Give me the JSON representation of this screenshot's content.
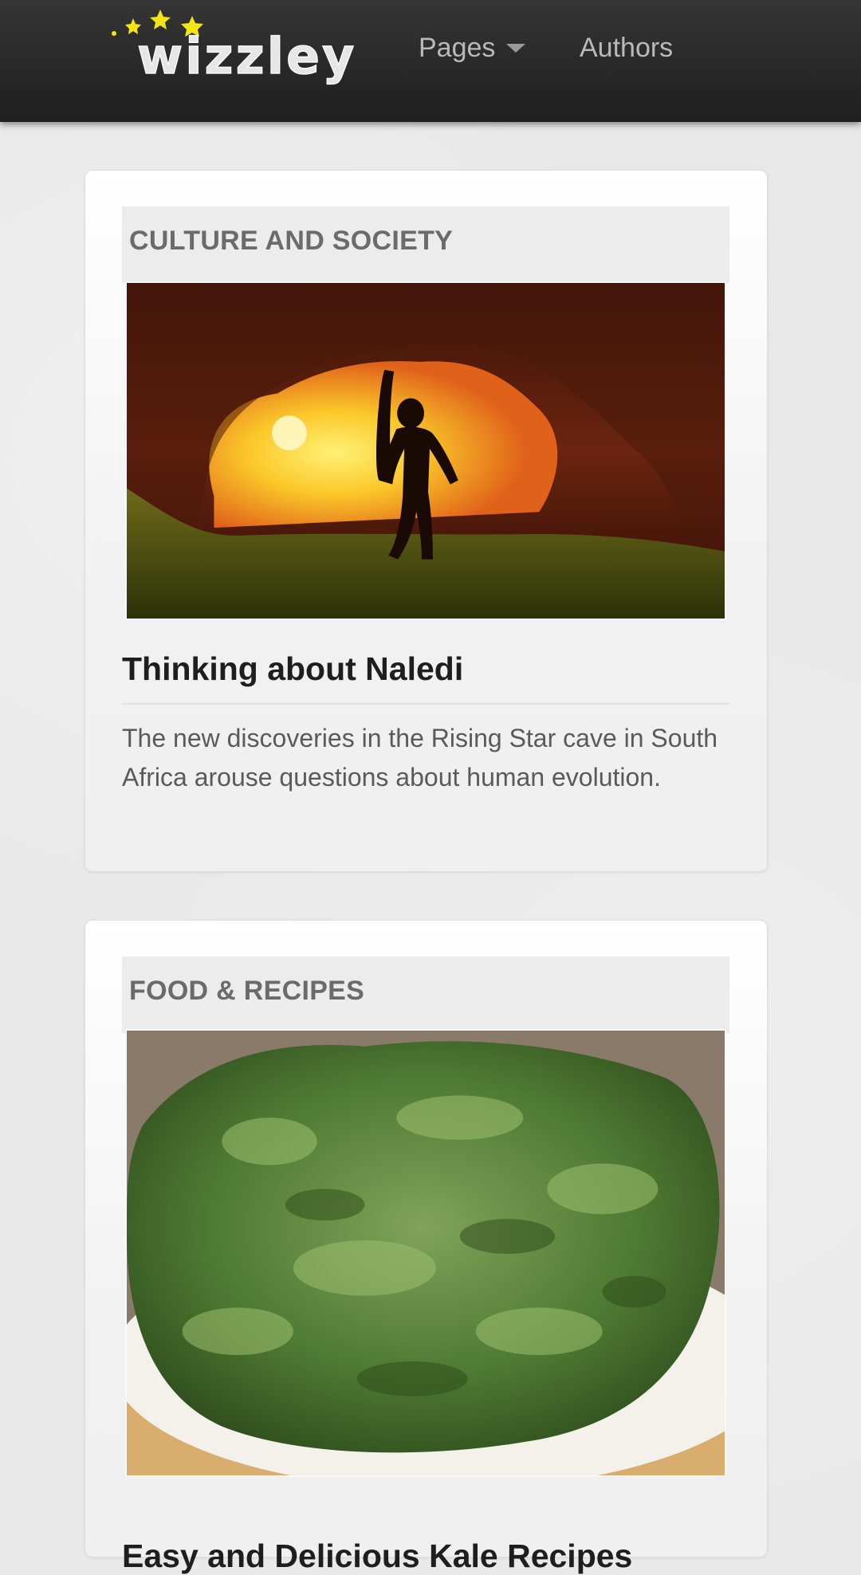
{
  "navbar": {
    "brand": "wizzley",
    "menu": [
      {
        "label": "Pages",
        "icon": "caret-down-icon"
      },
      {
        "label": "Authors"
      }
    ]
  },
  "articles": [
    {
      "category": "CULTURE AND SOCIETY",
      "title": "Thinking about Naledi",
      "description": "The new discoveries in the Rising Star cave in South Africa arouse questions about human evolution."
    },
    {
      "category": "FOOD & RECIPES",
      "title": "Easy and Delicious Kale Recipes"
    }
  ]
}
